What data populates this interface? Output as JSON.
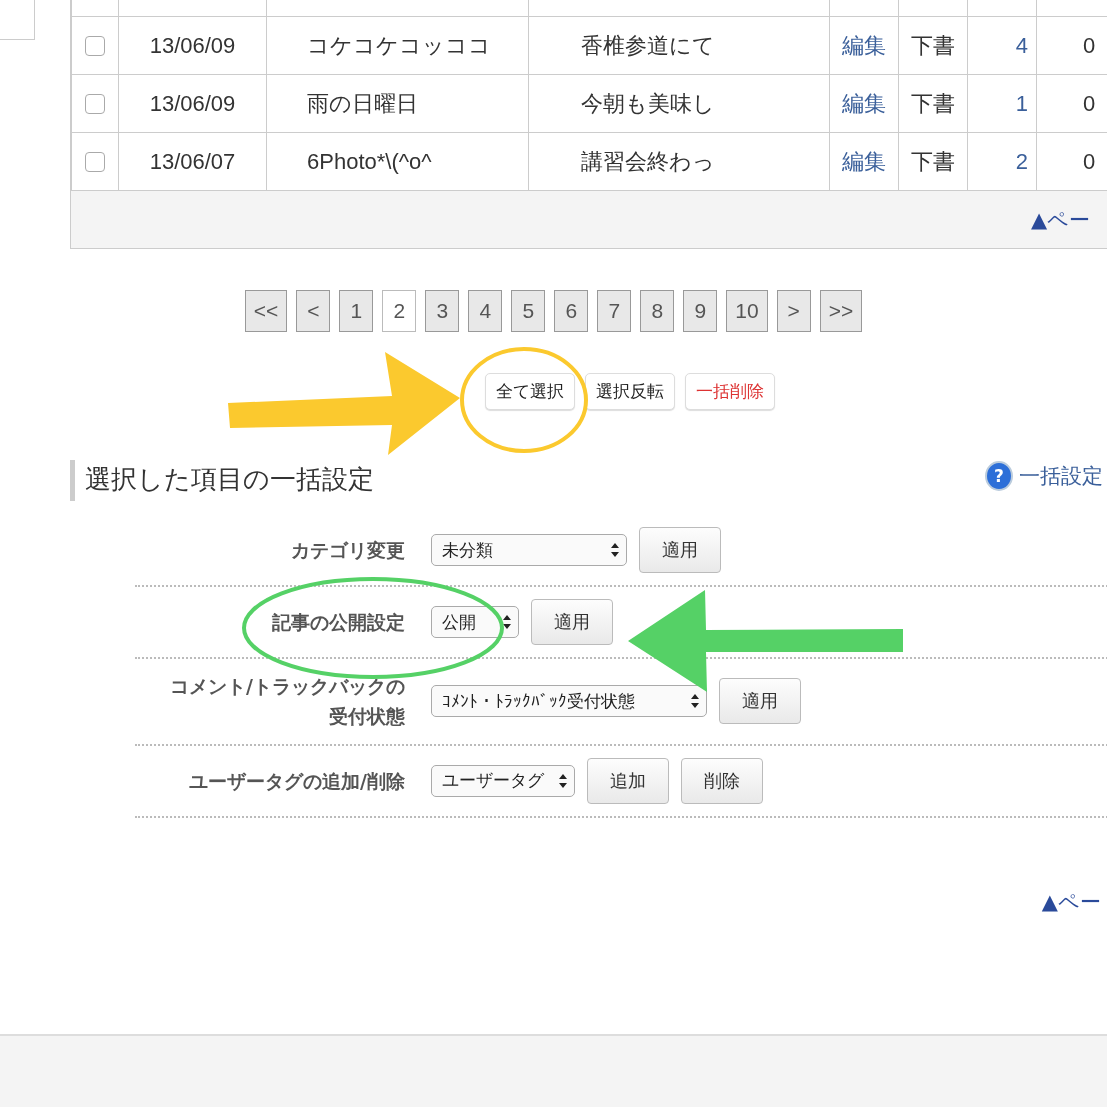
{
  "posts": {
    "rows": [
      {
        "checked": false,
        "date": "13/06/09",
        "title": "コケコケコッココ",
        "excerpt": "香椎参道にて",
        "edit": "編集",
        "status": "下書",
        "count_1": "4",
        "count_2": "0"
      },
      {
        "checked": false,
        "date": "13/06/09",
        "title": "雨の日曜日",
        "excerpt": "今朝も美味し",
        "edit": "編集",
        "status": "下書",
        "count_1": "1",
        "count_2": "0"
      },
      {
        "checked": false,
        "date": "13/06/07",
        "title": "6Photo*\\(^o^",
        "excerpt": "講習会終わっ",
        "edit": "編集",
        "status": "下書",
        "count_1": "2",
        "count_2": "0"
      }
    ],
    "page_top": "▲ペー"
  },
  "pager": [
    {
      "label": "<<",
      "selected": false
    },
    {
      "label": "<",
      "selected": false
    },
    {
      "label": "1",
      "selected": false
    },
    {
      "label": "2",
      "selected": true
    },
    {
      "label": "3",
      "selected": false
    },
    {
      "label": "4",
      "selected": false
    },
    {
      "label": "5",
      "selected": false
    },
    {
      "label": "6",
      "selected": false
    },
    {
      "label": "7",
      "selected": false
    },
    {
      "label": "8",
      "selected": false
    },
    {
      "label": "9",
      "selected": false
    },
    {
      "label": "10",
      "selected": false
    },
    {
      "label": ">",
      "selected": false
    },
    {
      "label": ">>",
      "selected": false
    }
  ],
  "actions": [
    {
      "label": "全て選択",
      "kind": "normal"
    },
    {
      "label": "選択反転",
      "kind": "normal"
    },
    {
      "label": "一括削除",
      "kind": "danger"
    }
  ],
  "bulk_settings": {
    "title": "選択した項目の一括設定",
    "help_icon": "?",
    "help_link": "一括設定",
    "rows": [
      {
        "label": "カテゴリ変更",
        "select": "未分類",
        "buttons": [
          "適用"
        ]
      },
      {
        "label": "記事の公開設定",
        "select": "公開",
        "buttons": [
          "適用"
        ]
      },
      {
        "label": "コメント/トラックバックの受付状態",
        "select": "ｺﾒﾝﾄ・ﾄﾗｯｸﾊﾞｯｸ受付状態",
        "buttons": [
          "適用"
        ]
      },
      {
        "label": "ユーザータグの追加/削除",
        "select": "ユーザータグ",
        "buttons": [
          "追加",
          "削除"
        ]
      }
    ],
    "page_top": "▲ペー"
  },
  "annotations": [
    {
      "kind": "arrow",
      "color": "#fbc92e"
    },
    {
      "kind": "ring",
      "color": "#fbc92e"
    },
    {
      "kind": "arrow",
      "color": "#55d166"
    },
    {
      "kind": "ring",
      "color": "#55d166"
    }
  ]
}
